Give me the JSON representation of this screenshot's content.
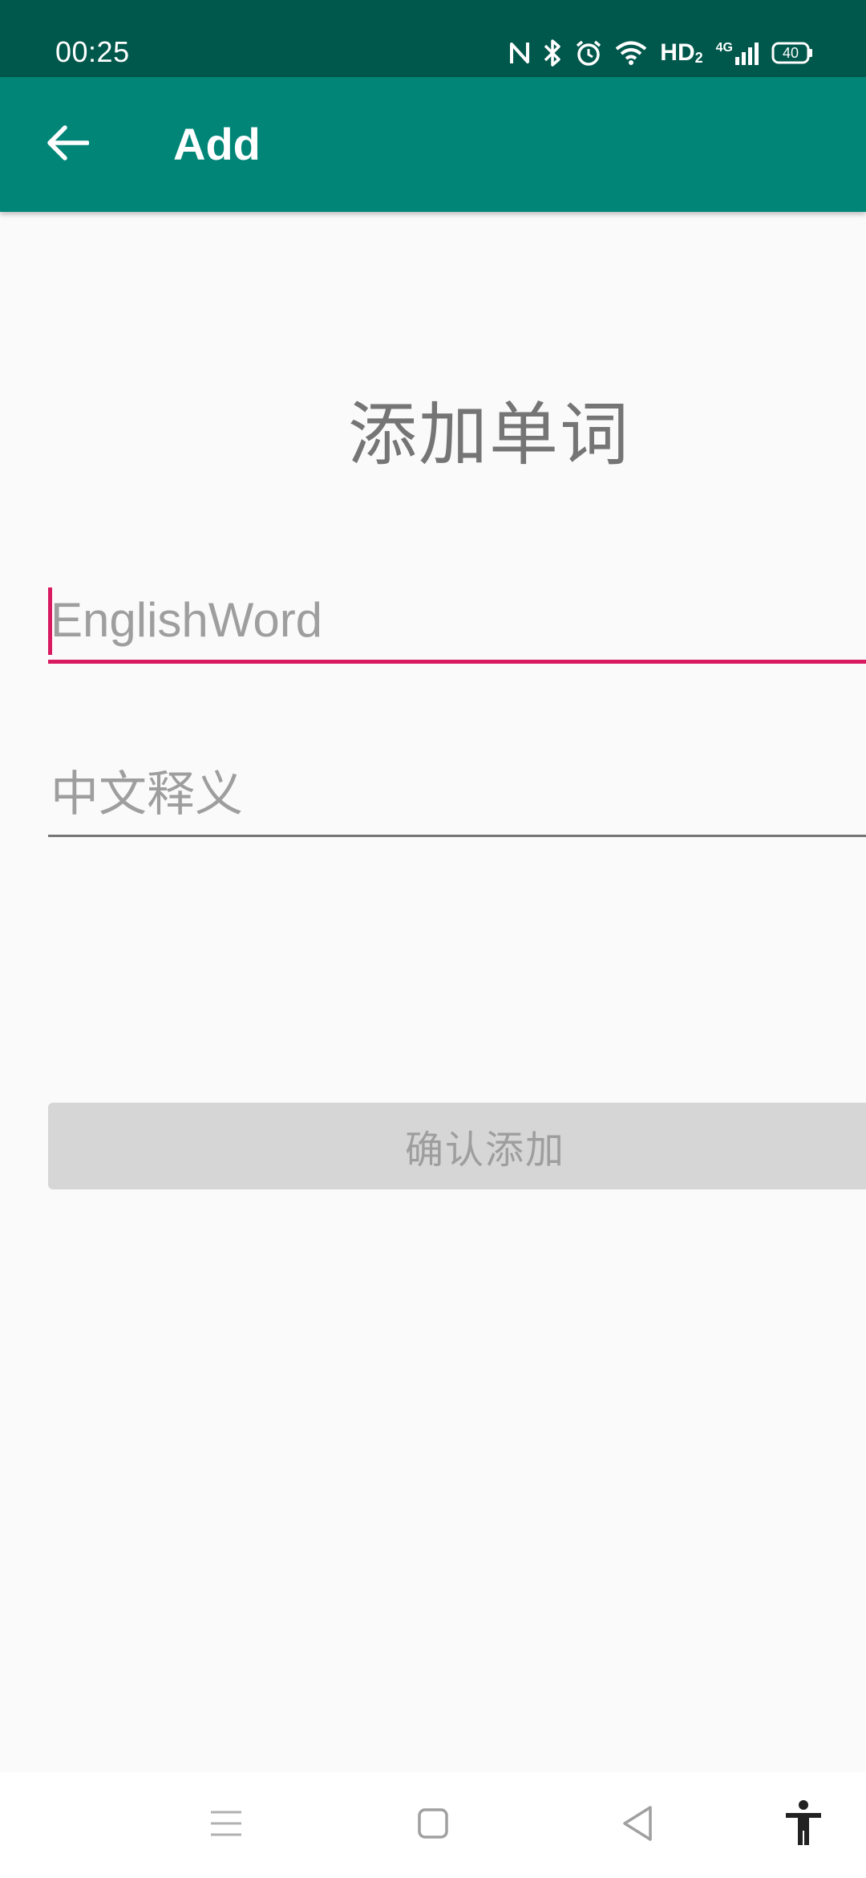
{
  "status_bar": {
    "time": "00:25",
    "network_label": "HD",
    "network_sub": "2",
    "cell_label": "4G",
    "battery_level": "40",
    "icons": [
      "nfc-icon",
      "bluetooth-icon",
      "alarm-icon",
      "wifi-icon",
      "hd-voice-icon",
      "cellular-4g-icon",
      "battery-icon"
    ]
  },
  "app_bar": {
    "title": "Add",
    "back_icon": "arrow-back-icon"
  },
  "form": {
    "heading": "添加单词",
    "english_placeholder": "EnglishWord",
    "chinese_placeholder": "中文释义",
    "confirm_label": "确认添加"
  },
  "colors": {
    "status_bar": "#00574b",
    "app_bar": "#008577",
    "accent": "#d81b60",
    "button_disabled_bg": "#d6d6d6"
  },
  "nav_bar": {
    "icons": [
      "menu-icon",
      "home-icon",
      "back-triangle-icon",
      "accessibility-icon"
    ]
  }
}
